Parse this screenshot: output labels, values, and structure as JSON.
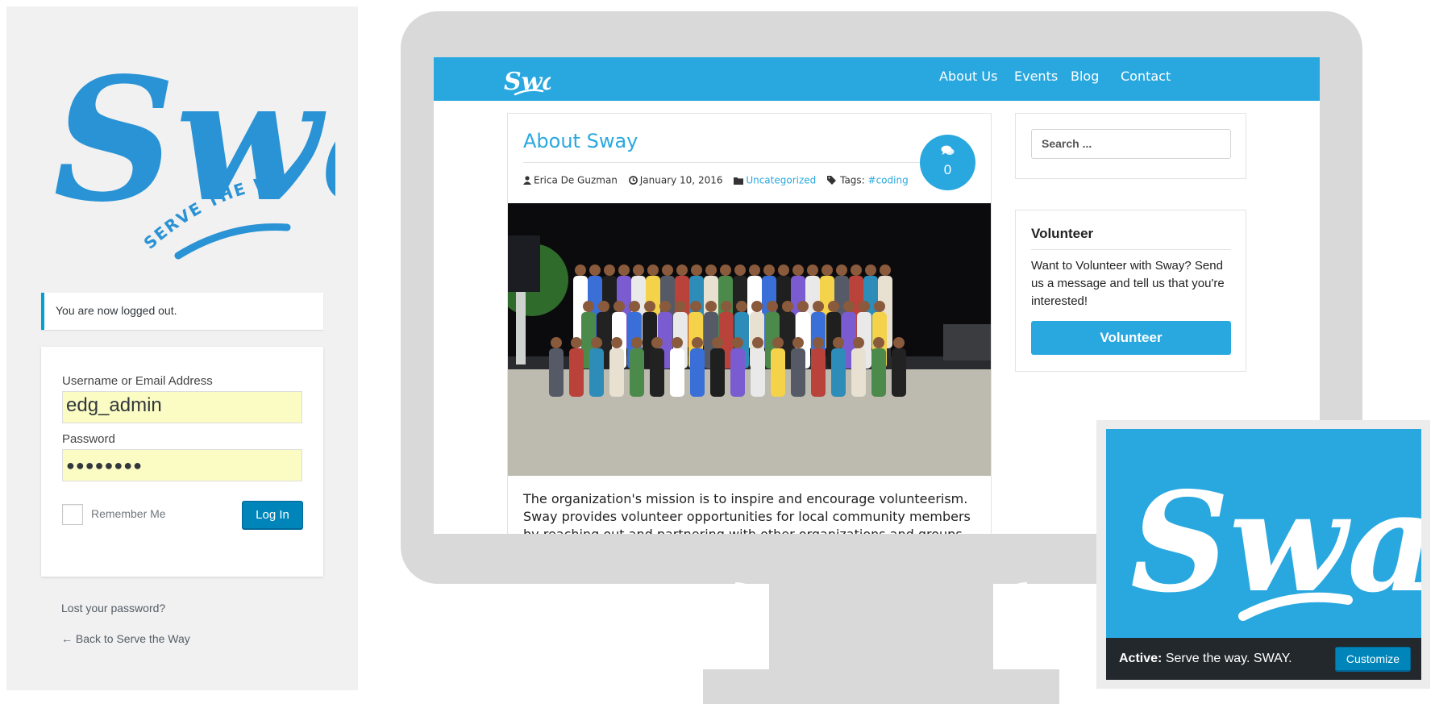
{
  "login": {
    "logo_text": "Sway",
    "logo_tagline": "SERVE THE WAY",
    "notice": "You are now logged out.",
    "username_label": "Username or Email Address",
    "username_value": "edg_admin",
    "password_label": "Password",
    "password_value": "●●●●●●●●",
    "remember_label": "Remember Me",
    "login_button": "Log In",
    "lost_password": "Lost your password?",
    "back_link": "← Back to Serve the Way"
  },
  "site": {
    "logo_text": "Sway",
    "nav": [
      "About Us",
      "Events",
      "Blog",
      "Contact"
    ],
    "post": {
      "title": "About Sway",
      "comment_count": "0",
      "author": "Erica De Guzman",
      "date": "January 10, 2016",
      "category": "Uncategorized",
      "tags_label": "Tags:",
      "tag": "#coding",
      "excerpt": "The organization's mission is to inspire and encourage volunteerism. Sway provides volunteer opportunities for local community members by reaching out and partnering with other organizations and groups."
    },
    "search_placeholder": "Search ...",
    "volunteer": {
      "title": "Volunteer",
      "text": "Want to Volunteer with Sway? Send us a message and tell us that you're interested!",
      "button": "Volunteer"
    }
  },
  "theme": {
    "logo_text": "Sway",
    "active_label": "Active:",
    "active_name": "Serve the way. SWAY.",
    "customize_button": "Customize"
  },
  "colors": {
    "brand_blue": "#29a8e0",
    "wp_button": "#0085ba",
    "admin_dark": "#23282d",
    "autofill_yellow": "#fbfbc4"
  }
}
